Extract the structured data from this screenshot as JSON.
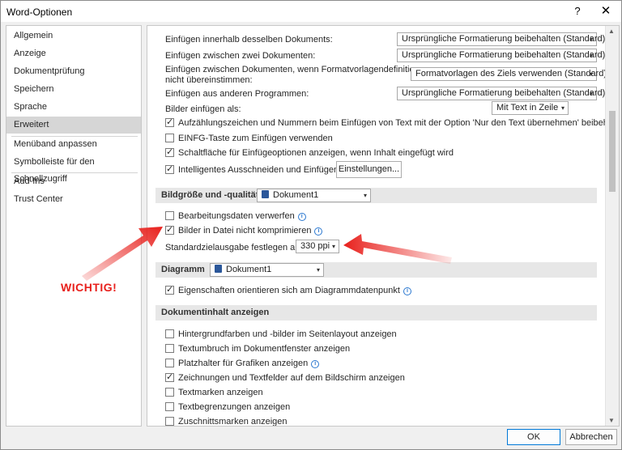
{
  "window": {
    "title": "Word-Optionen",
    "help": "?",
    "close": "✕"
  },
  "sidebar": {
    "items": [
      {
        "label": "Allgemein"
      },
      {
        "label": "Anzeige"
      },
      {
        "label": "Dokumentprüfung"
      },
      {
        "label": "Speichern"
      },
      {
        "label": "Sprache"
      },
      {
        "label": "Erweitert"
      },
      {
        "label": "Menüband anpassen"
      },
      {
        "label": "Symbolleiste für den Schnellzugriff"
      },
      {
        "label": "Add-Ins"
      },
      {
        "label": "Trust Center"
      }
    ],
    "selected": "Erweitert"
  },
  "paste": {
    "rows": [
      {
        "label": "Einfügen innerhalb desselben Dokuments:",
        "value": "Ursprüngliche Formatierung beibehalten (Standard)"
      },
      {
        "label": "Einfügen zwischen zwei Dokumenten:",
        "value": "Ursprüngliche Formatierung beibehalten (Standard)"
      },
      {
        "label": "Einfügen zwischen Dokumenten, wenn Formatvorlagendefinitionen",
        "label2": "nicht übereinstimmen:",
        "value": "Formatvorlagen des Ziels verwenden (Standard)"
      },
      {
        "label": "Einfügen aus anderen Programmen:",
        "value": "Ursprüngliche Formatierung beibehalten (Standard)"
      }
    ],
    "pictures_label": "Bilder einfügen als:",
    "pictures_value": "Mit Text in Zeile",
    "checks": [
      {
        "label": "Aufzählungszeichen und Nummern beim Einfügen von Text mit der Option 'Nur den Text übernehmen' beibehalten",
        "checked": true
      },
      {
        "label": "EINFG-Taste zum Einfügen verwenden",
        "checked": false
      },
      {
        "label": "Schaltfläche für Einfügeoptionen anzeigen, wenn Inhalt eingefügt wird",
        "checked": true
      },
      {
        "label": "Intelligentes Ausschneiden und Einfügen",
        "checked": true
      }
    ],
    "settings_button": "Einstellungen..."
  },
  "image_size": {
    "title": "Bildgröße und -qualität",
    "document": "Dokument1",
    "checks": [
      {
        "label": "Bearbeitungsdaten verwerfen",
        "checked": false
      },
      {
        "label": "Bilder in Datei nicht komprimieren",
        "checked": true
      }
    ],
    "ppi_label": "Standardzielausgabe festlegen auf:",
    "ppi_value": "330 ppi"
  },
  "chart": {
    "title": "Diagramm",
    "document": "Dokument1",
    "checks": [
      {
        "label": "Eigenschaften orientieren sich am Diagrammdatenpunkt",
        "checked": true
      }
    ]
  },
  "show_content": {
    "title": "Dokumentinhalt anzeigen",
    "checks": [
      {
        "label": "Hintergrundfarben und -bilder im Seitenlayout anzeigen",
        "checked": false
      },
      {
        "label": "Textumbruch im Dokumentfenster anzeigen",
        "checked": false
      },
      {
        "label": "Platzhalter für Grafiken anzeigen",
        "checked": false
      },
      {
        "label": "Zeichnungen und Textfelder auf dem Bildschirm anzeigen",
        "checked": true
      },
      {
        "label": "Textmarken anzeigen",
        "checked": false
      },
      {
        "label": "Textbegrenzungen anzeigen",
        "checked": false
      },
      {
        "label": "Zuschnittsmarken anzeigen",
        "checked": false
      }
    ]
  },
  "footer": {
    "ok": "OK",
    "cancel": "Abbrechen"
  },
  "annotation": {
    "text": "WICHTIG!",
    "color": "#e8201c"
  },
  "icons": {
    "checkmark": "✓",
    "info": "i",
    "dropdown": "▾",
    "scroll_up": "▲",
    "scroll_down": "▼"
  }
}
